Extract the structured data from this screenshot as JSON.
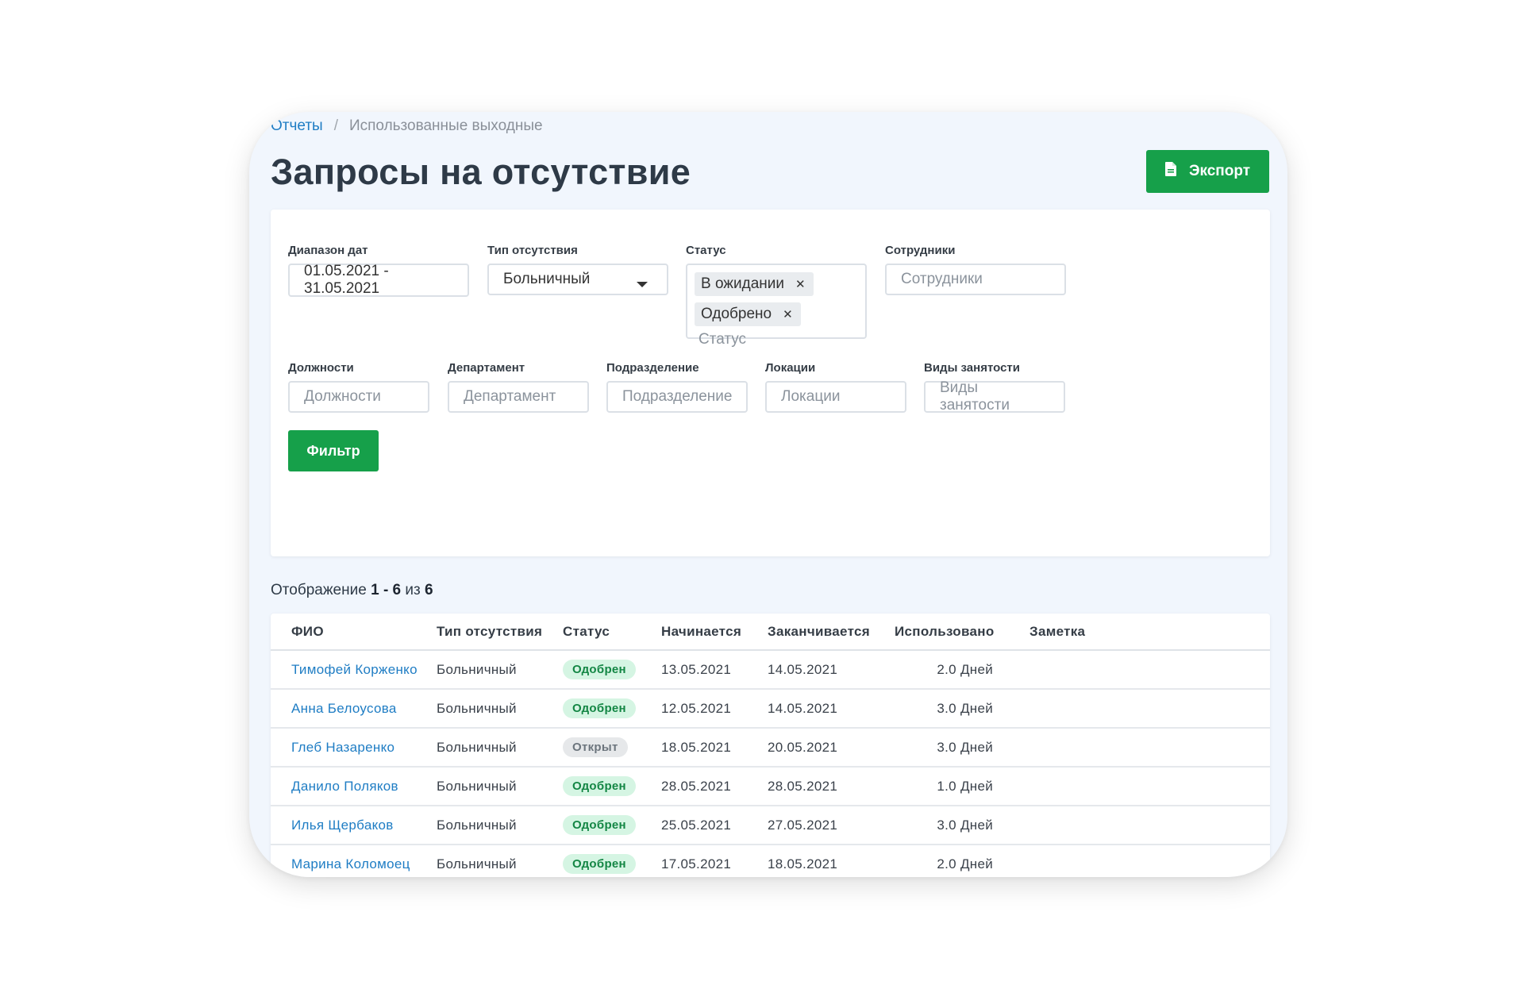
{
  "breadcrumb": {
    "parent": "Отчеты",
    "separator": "/",
    "current": "Использованные выходные"
  },
  "page_title": "Запросы на отсутствие",
  "export_button": {
    "label": "Экспорт",
    "icon": "file-icon"
  },
  "filters": {
    "date_range": {
      "label": "Диапазон дат",
      "value": "01.05.2021 - 31.05.2021"
    },
    "absence_type": {
      "label": "Тип отсутствия",
      "value": "Больничный"
    },
    "status": {
      "label": "Статус",
      "tags": [
        "В ожидании",
        "Одобрено"
      ],
      "placeholder": "Статус"
    },
    "employees": {
      "label": "Сотрудники",
      "placeholder": "Сотрудники"
    },
    "positions": {
      "label": "Должности",
      "placeholder": "Должности"
    },
    "department": {
      "label": "Департамент",
      "placeholder": "Департамент"
    },
    "division": {
      "label": "Подразделение",
      "placeholder": "Подразделение"
    },
    "locations": {
      "label": "Локации",
      "placeholder": "Локации"
    },
    "employment_types": {
      "label": "Виды занятости",
      "placeholder": "Виды занятости"
    },
    "submit_label": "Фильтр"
  },
  "summary": {
    "prefix": "Отображение",
    "range": "1 - 6",
    "of": "из",
    "total": "6"
  },
  "table": {
    "columns": [
      "ФИО",
      "Тип отсутствия",
      "Статус",
      "Начинается",
      "Заканчивается",
      "Использовано",
      "Заметка"
    ],
    "rows": [
      {
        "name": "Тимофей Корженко",
        "type": "Больничный",
        "status": "Одобрен",
        "start": "13.05.2021",
        "end": "14.05.2021",
        "used": "2.0 Дней",
        "note": ""
      },
      {
        "name": "Анна Белоусова",
        "type": "Больничный",
        "status": "Одобрен",
        "start": "12.05.2021",
        "end": "14.05.2021",
        "used": "3.0 Дней",
        "note": ""
      },
      {
        "name": "Глеб Назаренко",
        "type": "Больничный",
        "status": "Открыт",
        "start": "18.05.2021",
        "end": "20.05.2021",
        "used": "3.0 Дней",
        "note": ""
      },
      {
        "name": "Данило Поляков",
        "type": "Больничный",
        "status": "Одобрен",
        "start": "28.05.2021",
        "end": "28.05.2021",
        "used": "1.0 Дней",
        "note": ""
      },
      {
        "name": "Илья Щербаков",
        "type": "Больничный",
        "status": "Одобрен",
        "start": "25.05.2021",
        "end": "27.05.2021",
        "used": "3.0 Дней",
        "note": ""
      },
      {
        "name": "Марина Коломоец",
        "type": "Больничный",
        "status": "Одобрен",
        "start": "17.05.2021",
        "end": "18.05.2021",
        "used": "2.0 Дней",
        "note": ""
      }
    ]
  },
  "colors": {
    "accent": "#16a04a",
    "link": "#1f7dc4",
    "approved_bg": "#d5f5e3",
    "approved_text": "#138644",
    "open_bg": "#e6e8ea",
    "open_text": "#6c757d"
  }
}
